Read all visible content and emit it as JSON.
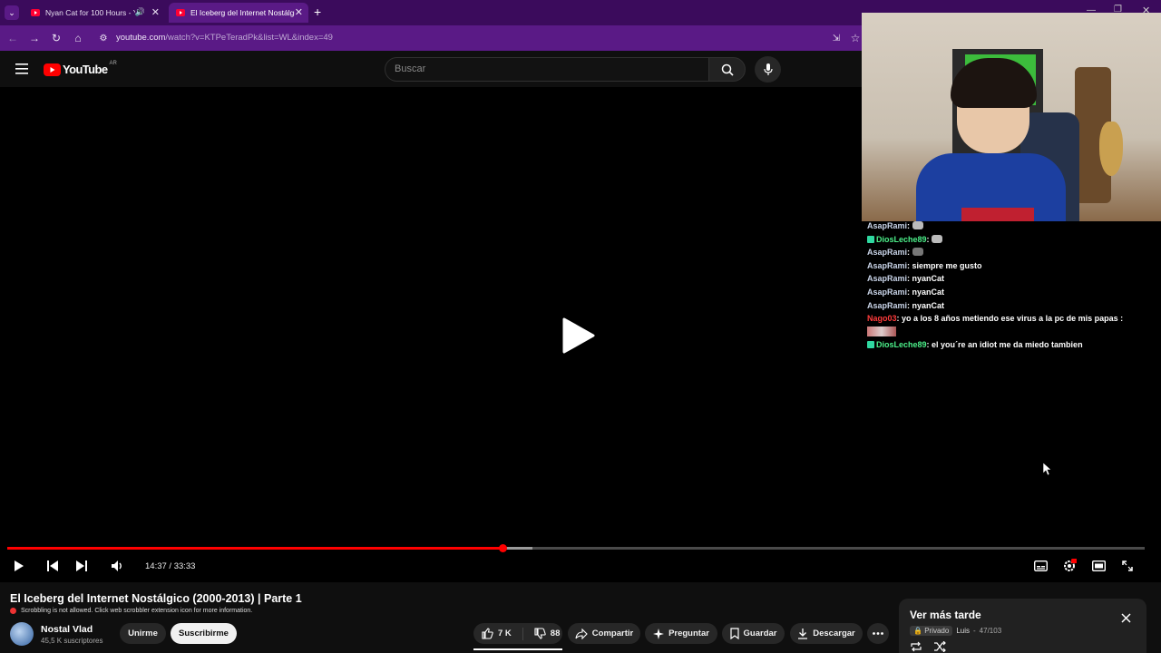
{
  "browser": {
    "tabs": [
      {
        "label": "Nyan Cat for 100 Hours - Yo",
        "active": false,
        "audio": true
      },
      {
        "label": "El Iceberg del Internet Nostálgi",
        "active": true
      }
    ],
    "url_host": "youtube.com",
    "url_path": "/watch?v=KTPeTeradPk&list=WL&index=49"
  },
  "youtube": {
    "logo": "YouTube",
    "region": "AR",
    "search_placeholder": "Buscar"
  },
  "player": {
    "current_time": "14:37",
    "duration": "33:33",
    "time_display": "14:37 / 33:33",
    "progress_fraction": 0.436,
    "buffered_fraction": 0.462
  },
  "chat": [
    {
      "user": "AsapRami",
      "text": "",
      "emote": true,
      "user_color": "#c9d4e8"
    },
    {
      "user": "DiosLeche89",
      "text": "",
      "emote": true,
      "badge": true,
      "user_color": "#4cf08a"
    },
    {
      "user": "AsapRami",
      "text": "",
      "emote": true,
      "user_color": "#c9d4e8"
    },
    {
      "user": "AsapRami",
      "text": "siempre me gusto",
      "user_color": "#c9d4e8"
    },
    {
      "user": "AsapRami",
      "text": "nyanCat",
      "user_color": "#c9d4e8"
    },
    {
      "user": "AsapRami",
      "text": "nyanCat",
      "user_color": "#c9d4e8"
    },
    {
      "user": "AsapRami",
      "text": "nyanCat",
      "user_color": "#c9d4e8"
    },
    {
      "user": "Nago03",
      "text": "yo a los 8 años metiendo ese virus a la pc de mis papas :",
      "user_color": "#ff3b3b",
      "image_after": true
    },
    {
      "user": "DiosLeche89",
      "text": "el you´re an idiot me da miedo tambien",
      "badge": true,
      "user_color": "#4cf08a"
    }
  ],
  "video": {
    "title": "El Iceberg del Internet Nostálgico (2000-2013) | Parte 1",
    "scrobble_notice": "Scrobbling is not allowed. Click web scrobbler extension icon for more information.",
    "channel": "Nostal Vlad",
    "subscribers": "45,5 K suscriptores",
    "join_label": "Unirme",
    "subscribe_label": "Suscribirme",
    "likes": "7 K",
    "dislikes": "88",
    "share_label": "Compartir",
    "ask_label": "Preguntar",
    "save_label": "Guardar",
    "download_label": "Descargar"
  },
  "playlist_panel": {
    "title": "Ver más tarde",
    "privacy": "Privado",
    "owner": "Luis",
    "position": "47/103"
  },
  "colors": {
    "accent": "#ff0000",
    "browser_tabbar": "#3b0b5c",
    "browser_toolbar": "#5a1a86"
  }
}
